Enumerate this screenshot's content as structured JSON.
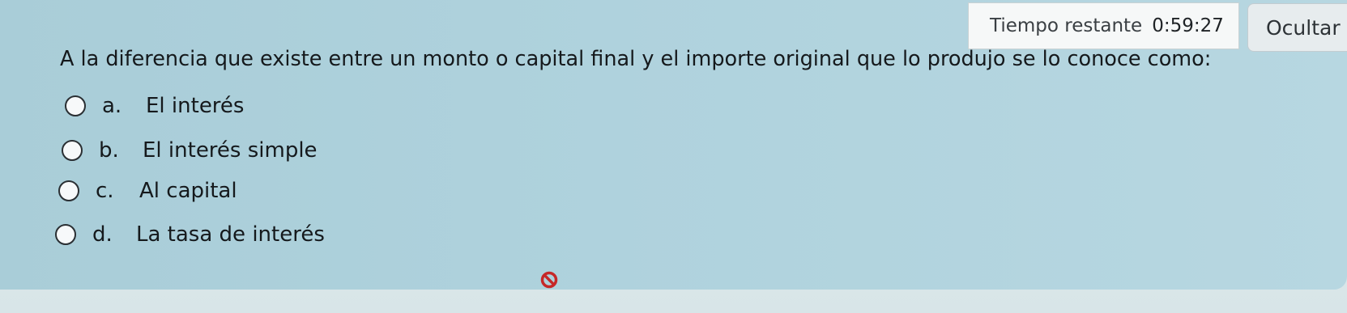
{
  "timer": {
    "label": "Tiempo restante",
    "value": "0:59:27"
  },
  "hide_button": {
    "label": "Ocultar"
  },
  "question": {
    "text": "A la diferencia que existe entre un monto o capital final y el importe original que lo produjo se lo conoce como:"
  },
  "options": [
    {
      "letter": "a.",
      "text": "El interés",
      "selected": false
    },
    {
      "letter": "b.",
      "text": "El interés simple",
      "selected": false
    },
    {
      "letter": "c.",
      "text": "Al capital",
      "selected": false
    },
    {
      "letter": "d.",
      "text": "La tasa de interés",
      "selected": false
    }
  ],
  "icons": {
    "feedback": "prohibited-icon",
    "feedback_color": "#c62828"
  }
}
